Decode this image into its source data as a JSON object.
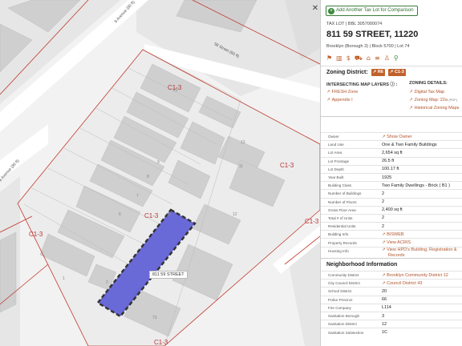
{
  "map": {
    "streets": [
      {
        "label": "8 Avenue (80 ft)"
      },
      {
        "label": "58 Street (60 ft)"
      },
      {
        "label": "8 Avenue (80 ft)"
      }
    ],
    "zones": [
      "C1-3",
      "C1-3",
      "C1-3",
      "C1-3",
      "C1-3",
      "C1-3"
    ],
    "lot_numbers": [
      "29",
      "12",
      "16",
      "1",
      "2",
      "73",
      "9",
      "8",
      "7",
      "6",
      "13",
      "11"
    ],
    "tooltip": "811 59 STREET",
    "colors": {
      "zone_line": "#c0392b",
      "lot_fill": "#5b5bd6",
      "lot_border": "#333333",
      "road": "#ffffff",
      "building": "#cfcfcf"
    }
  },
  "panel": {
    "add_button": "Add Another Tax Lot for Comparison",
    "close_icon": "close-icon",
    "tax_sub": "TAX LOT | BBL 3057000074",
    "address": "811 59 STREET, 11220",
    "boro_line": "Brooklyn (Borough 3) | Block 5700 | Lot 74",
    "icons": [
      "flag-icon",
      "chart-icon",
      "dollar-icon",
      "bus-icon",
      "building-icon",
      "equals-icon",
      "person-icon",
      "map-pin-icon"
    ],
    "zoning_label": "Zoning District:",
    "zoning_badges": [
      "R6",
      "C1-3"
    ],
    "map_layers_head": "INTERSECTING MAP LAYERS",
    "map_layers": [
      "FRESH Zone",
      "Appendix I"
    ],
    "zoning_details_head": "ZONING DETAILS:",
    "zoning_details": [
      "Digital Tax Map",
      "Zoning Map: 22a",
      "Historical Zoning Maps"
    ],
    "zoning_map_sup": "(PDF)",
    "attributes": [
      {
        "key": "Owner",
        "value": "Show Owner",
        "link": true
      },
      {
        "key": "Land Use",
        "value": "One & Two Family Buildings",
        "link": false
      },
      {
        "key": "Lot Area",
        "value": "2,654 sq ft",
        "link": false
      },
      {
        "key": "Lot Frontage",
        "value": "26.5 ft",
        "link": false
      },
      {
        "key": "Lot Depth",
        "value": "100.17 ft",
        "link": false
      },
      {
        "key": "Year Built",
        "value": "1925",
        "link": false
      },
      {
        "key": "Building Class",
        "value": "Two Family Dwellings - Brick ( B1 )",
        "link": false
      },
      {
        "key": "Number of Buildings",
        "value": "2",
        "link": false
      },
      {
        "key": "Number of Floors",
        "value": "2",
        "link": false
      },
      {
        "key": "Gross Floor Area",
        "value": "2,400 sq ft",
        "link": false
      },
      {
        "key": "Total # of Units",
        "value": "2",
        "link": false
      },
      {
        "key": "Residential Units",
        "value": "2",
        "link": false
      },
      {
        "key": "Building Info",
        "value": "BISWEB",
        "link": true
      },
      {
        "key": "Property Records",
        "value": "View ACRIS",
        "link": true
      },
      {
        "key": "Housing Info",
        "value": "View HPD's Building, Registration &",
        "value2": "Records",
        "link": true
      }
    ],
    "neighborhood_head": "Neighborhood Information",
    "neighborhood": [
      {
        "key": "Community District",
        "value": "Brooklyn Community District 12",
        "link": true
      },
      {
        "key": "City Council District",
        "value": "Council District 43",
        "link": true
      },
      {
        "key": "School District",
        "value": "20",
        "link": false
      },
      {
        "key": "Police Precinct",
        "value": "66",
        "link": false
      },
      {
        "key": "Fire Company",
        "value": "L114",
        "link": false
      },
      {
        "key": "Sanitation Borough",
        "value": "3",
        "link": false
      },
      {
        "key": "Sanitation District",
        "value": "12",
        "link": false
      },
      {
        "key": "Sanitation Subsection",
        "value": "1C",
        "link": false
      }
    ]
  }
}
